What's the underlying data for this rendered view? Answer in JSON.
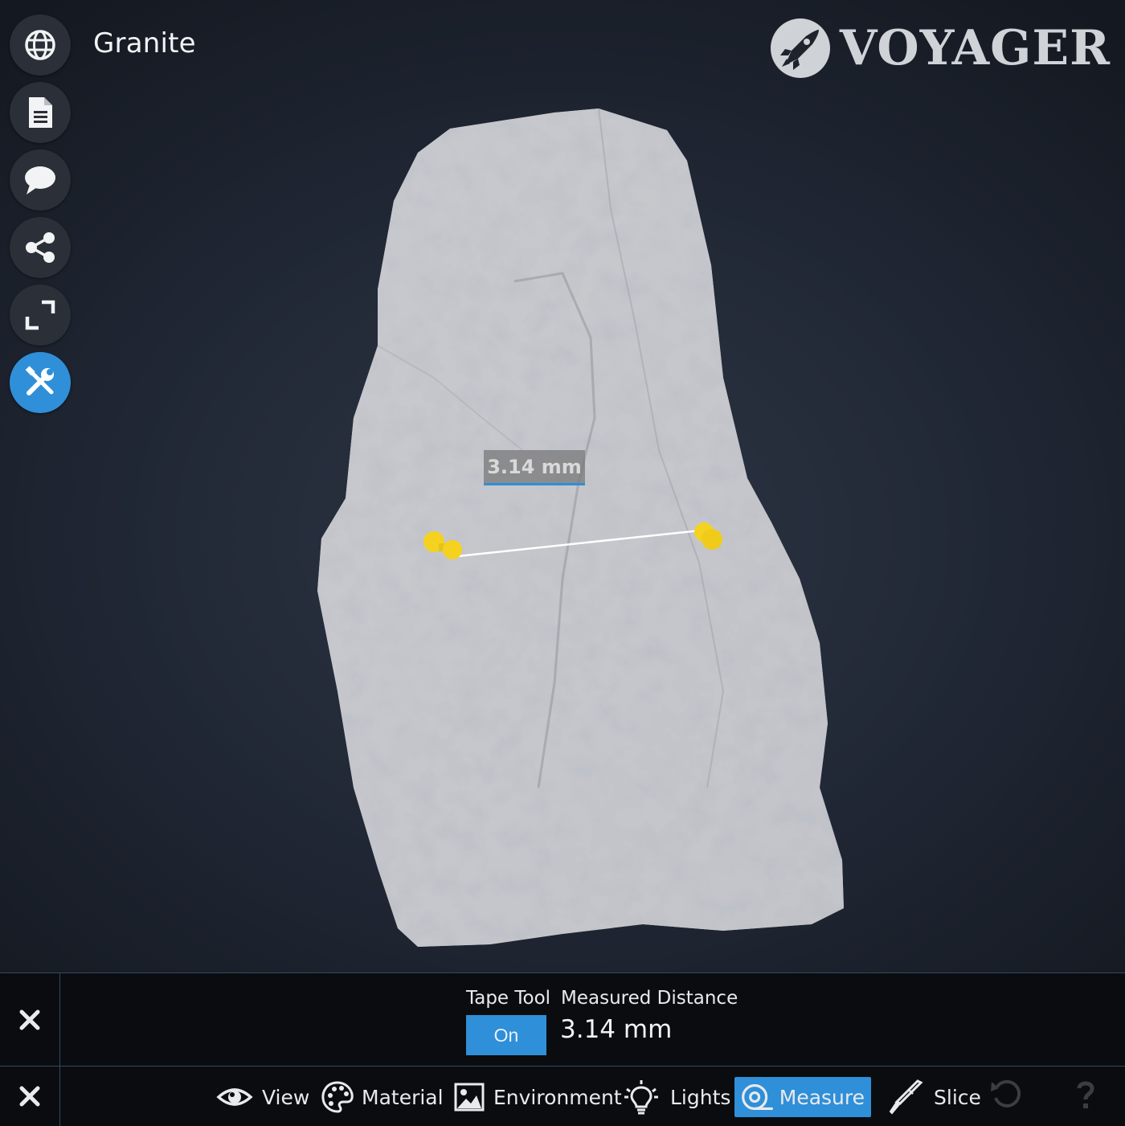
{
  "header": {
    "title": "Granite",
    "logo_text": "VOYAGER"
  },
  "sidebar": {
    "items": [
      {
        "name": "globe-icon"
      },
      {
        "name": "document-icon"
      },
      {
        "name": "comment-icon"
      },
      {
        "name": "share-icon"
      },
      {
        "name": "fullscreen-icon"
      },
      {
        "name": "tools-icon",
        "active": true
      }
    ]
  },
  "viewport": {
    "measurement_label": "3.14 mm",
    "pin_color": "#f5d21f"
  },
  "tape_panel": {
    "tape_tool_label": "Tape Tool",
    "toggle_label": "On",
    "measured_label": "Measured Distance",
    "measured_value": "3.14 mm"
  },
  "toolbar": {
    "view": "View",
    "material": "Material",
    "environment": "Environment",
    "lights": "Lights",
    "measure": "Measure",
    "slice": "Slice",
    "active_tool": "Measure"
  },
  "colors": {
    "accent": "#2f8fd8",
    "background": "#0b0c0f"
  }
}
